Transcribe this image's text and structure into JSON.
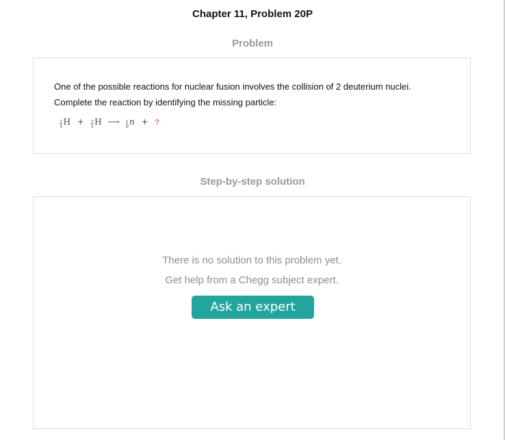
{
  "header": {
    "chapter_title": "Chapter 11, Problem 20P"
  },
  "problem": {
    "heading": "Problem",
    "line1": "One of the possible reactions for nuclear fusion involves the collision of 2 deuterium nuclei.",
    "line2": "Complete the reaction by identifying the missing particle:",
    "equation": {
      "reactant1": {
        "mass": "2",
        "atomic": "1",
        "symbol": "H"
      },
      "plus": "+",
      "reactant2": {
        "mass": "2",
        "atomic": "1",
        "symbol": "H"
      },
      "arrow": "⟶",
      "product1": {
        "mass": "1",
        "atomic": "0",
        "symbol": "n"
      },
      "plus2": "+",
      "missing": "?"
    }
  },
  "solution": {
    "heading": "Step-by-step solution",
    "message_line1": "There is no solution to this problem yet.",
    "message_line2": "Get help from a Chegg subject expert.",
    "ask_button_label": "Ask an expert"
  },
  "colors": {
    "accent": "#22a59c",
    "heading_gray": "#999999",
    "missing_red": "#e23030"
  }
}
